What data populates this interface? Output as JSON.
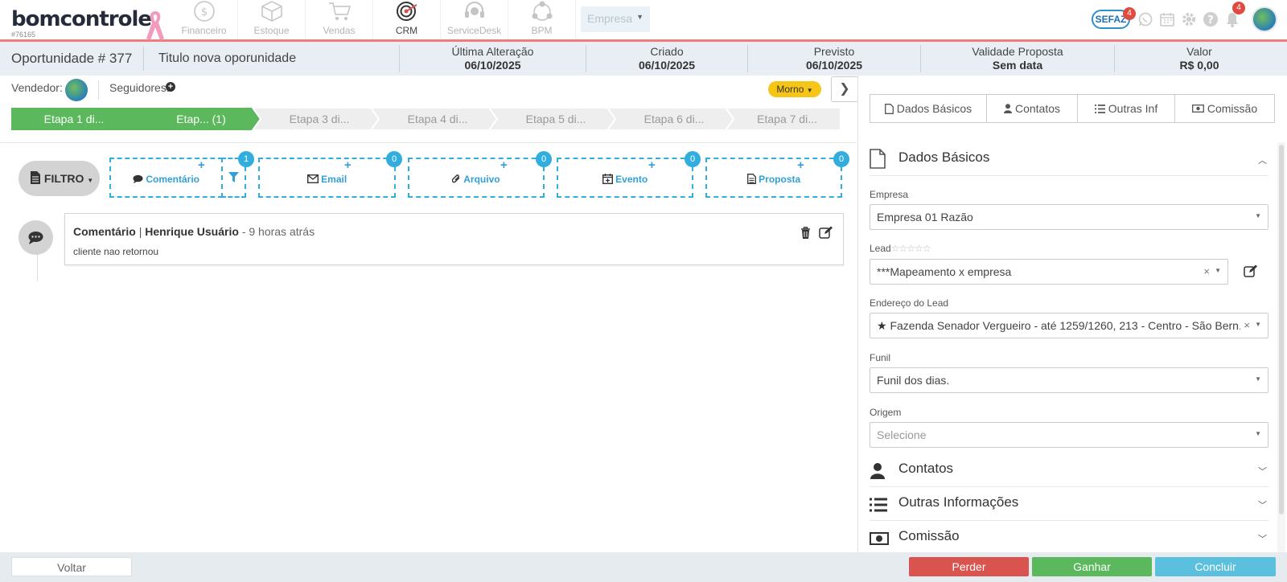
{
  "app": {
    "logo_text": "bomcontrole",
    "account_id": "#76165"
  },
  "modules": [
    {
      "label": "Financeiro",
      "icon": "dollar-circle-icon",
      "active": false
    },
    {
      "label": "Estoque",
      "icon": "box-icon",
      "active": false
    },
    {
      "label": "Vendas",
      "icon": "cart-icon",
      "active": false
    },
    {
      "label": "CRM",
      "icon": "target-icon",
      "active": true
    },
    {
      "label": "ServiceDesk",
      "icon": "headset-icon",
      "active": false
    },
    {
      "label": "BPM",
      "icon": "process-icon",
      "active": false
    }
  ],
  "company_select": {
    "value": "Empresa"
  },
  "top_right": {
    "sefaz_label": "SEFAZ",
    "sefaz_badge": "4",
    "notifications_badge": "4"
  },
  "opportunity": {
    "number_label": "Oportunidade # 377",
    "title": "Titulo nova oporunidade",
    "info": [
      {
        "label": "Última Alteração",
        "value": "06/10/2025"
      },
      {
        "label": "Criado",
        "value": "06/10/2025"
      },
      {
        "label": "Previsto",
        "value": "06/10/2025"
      },
      {
        "label": "Validade Proposta",
        "value": "Sem data"
      },
      {
        "label": "Valor",
        "value": "R$ 0,00"
      }
    ]
  },
  "people": {
    "seller_label": "Vendedor:",
    "followers_label": "Seguidores:"
  },
  "temperature": {
    "label": "Morno"
  },
  "stages": [
    {
      "label": "Etapa 1 di...",
      "done": true
    },
    {
      "label": "Etap... (1)",
      "done": true
    },
    {
      "label": "Etapa 3 di...",
      "done": false
    },
    {
      "label": "Etapa 4 di...",
      "done": false
    },
    {
      "label": "Etapa 5 di...",
      "done": false
    },
    {
      "label": "Etapa 6 di...",
      "done": false
    },
    {
      "label": "Etapa 7 di...",
      "done": false
    }
  ],
  "filter": {
    "label": "FILTRO"
  },
  "actions": [
    {
      "label": "Comentário",
      "count": "1"
    },
    {
      "label": "Email",
      "count": "0"
    },
    {
      "label": "Arquivo",
      "count": "0"
    },
    {
      "label": "Evento",
      "count": "0"
    },
    {
      "label": "Proposta",
      "count": "0"
    }
  ],
  "timeline": [
    {
      "type": "Comentário",
      "separator": "|",
      "author": "Henrique Usuário",
      "time": "- 9 horas atrás",
      "text": "cliente nao retornou"
    }
  ],
  "right_tabs": [
    {
      "label": "Dados Básicos",
      "icon": "file-icon"
    },
    {
      "label": "Contatos",
      "icon": "user-icon"
    },
    {
      "label": "Outras Inf",
      "icon": "list-icon"
    },
    {
      "label": "Comissão",
      "icon": "money-icon"
    }
  ],
  "dados_basicos": {
    "title": "Dados Básicos",
    "fields": {
      "empresa": {
        "label": "Empresa",
        "value": "Empresa 01 Razão"
      },
      "lead": {
        "label": "Lead",
        "value": "***Mapeamento x empresa",
        "rating": 0,
        "rating_max": 5
      },
      "endereco": {
        "label": "Endereço do Lead",
        "value": "Fazenda Senador Vergueiro - até 1259/1260, 213 - Centro - São Bern..."
      },
      "funil": {
        "label": "Funil",
        "value": "Funil dos dias."
      },
      "origem": {
        "label": "Origem",
        "placeholder": "Selecione"
      }
    }
  },
  "sections": [
    {
      "title": "Contatos",
      "icon": "user-icon"
    },
    {
      "title": "Outras Informações",
      "icon": "list-icon"
    },
    {
      "title": "Comissão",
      "icon": "money-icon"
    }
  ],
  "footer": {
    "back": "Voltar",
    "lose": "Perder",
    "win": "Ganhar",
    "finish": "Concluir"
  },
  "colors": {
    "accent_red": "#f07c7c",
    "stage_done": "#5cb85c",
    "action_blue": "#31aede",
    "lose": "#d9534f",
    "win": "#5cb85c",
    "finish": "#5bc0de",
    "temperature": "#f5c518"
  }
}
